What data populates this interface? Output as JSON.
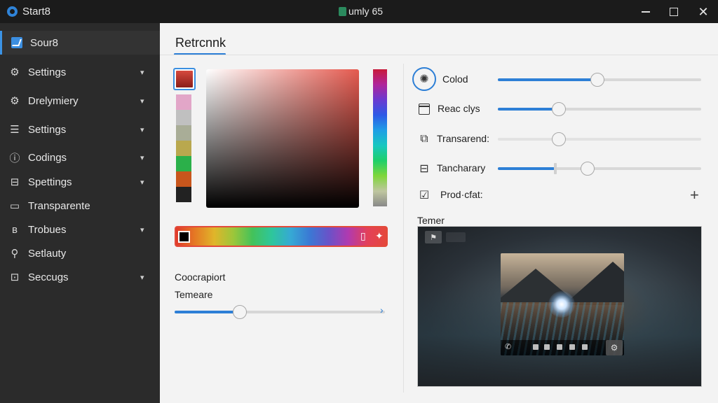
{
  "window": {
    "app_name": "Start8",
    "center_title": "umly 65"
  },
  "sidebar": {
    "items": [
      {
        "label": "Sour8",
        "icon": "edit-square-icon",
        "active": true,
        "chevron": false
      },
      {
        "label": "Settings",
        "icon": "gear-icon",
        "chevron": true
      },
      {
        "label": "Drelymiery",
        "icon": "gear-icon",
        "chevron": true
      },
      {
        "label": "Settings",
        "icon": "menu-lines-icon",
        "chevron": true
      },
      {
        "label": "Codings",
        "icon": "info-circle-icon",
        "chevron": true
      },
      {
        "label": "Spettings",
        "icon": "layout-icon",
        "chevron": true
      },
      {
        "label": "Transparente",
        "icon": "panel-icon",
        "chevron": false
      },
      {
        "label": "Trobues",
        "icon": "bluetooth-icon",
        "chevron": true
      },
      {
        "label": "Setlauty",
        "icon": "pin-icon",
        "chevron": false
      },
      {
        "label": "Seccugs",
        "icon": "window-icon",
        "chevron": true
      }
    ]
  },
  "main": {
    "heading": "Retrcnnk",
    "picker": {
      "selected_color": "#b8342c",
      "swatches": [
        "#e2a6c8",
        "#c0c0c0",
        "#a9ad97",
        "#b9a84e",
        "#2bb04a",
        "#c8561c",
        "#222222"
      ],
      "bar_icons": [
        "phone-icon",
        "sparkle-icon"
      ]
    },
    "label_a": "Coocrapiort",
    "label_b": "Temeare",
    "left_slider": {
      "value": 0.31
    },
    "settings": [
      {
        "label": "Colod",
        "icon": "badge-gear-icon",
        "value": 0.49
      },
      {
        "label": "Reac clys",
        "icon": "window-icon",
        "value": 0.3
      },
      {
        "label": "Transarend:",
        "icon": "copy-window-icon",
        "value": 0.3
      },
      {
        "label": "Tancharary",
        "icon": "monitor-icon",
        "value": 0.28
      },
      {
        "label": "Prod·cfat:",
        "icon": "checkbox-icon",
        "plus": "+"
      }
    ],
    "preview_label": "Temer"
  },
  "colors": {
    "accent": "#2d7fd6",
    "sidebar_bg": "#2b2b2b",
    "titlebar_bg": "#1b1b1b"
  }
}
